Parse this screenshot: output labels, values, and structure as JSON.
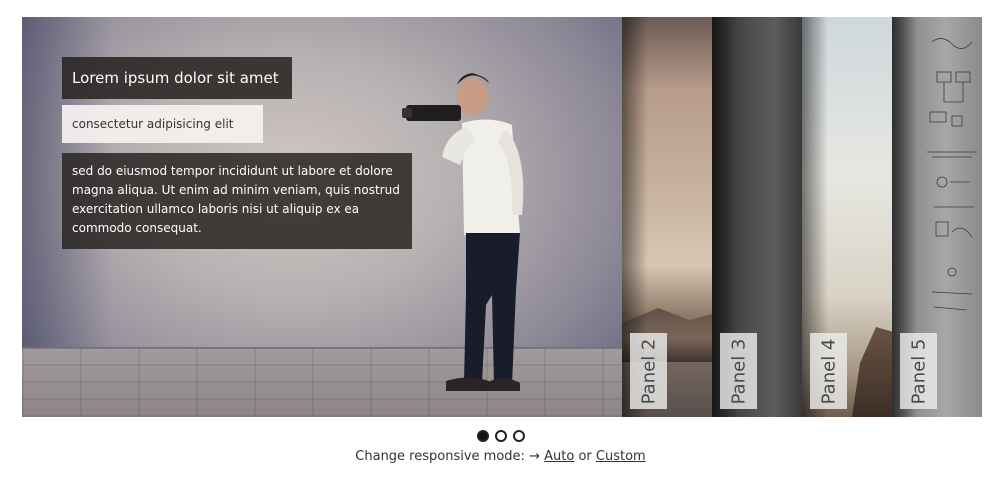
{
  "slider": {
    "active_panel": {
      "caption_title": "Lorem ipsum dolor sit amet",
      "caption_subtitle": "consectetur adipisicing elit",
      "caption_body": "sed do eiusmod tempor incididunt ut labore et dolore magna aliqua. Ut enim ad minim veniam, quis nostrud exercitation ullamco laboris nisi ut aliquip ex ea commodo consequat."
    },
    "panels": [
      {
        "label": "Panel 2"
      },
      {
        "label": "Panel 3"
      },
      {
        "label": "Panel 4"
      },
      {
        "label": "Panel 5"
      }
    ]
  },
  "pagination": {
    "count": 3,
    "active_index": 0
  },
  "footer": {
    "prefix": "Change responsive mode:",
    "arrow": "→",
    "auto_link": "Auto",
    "connector": "or",
    "custom_link": "Custom"
  }
}
